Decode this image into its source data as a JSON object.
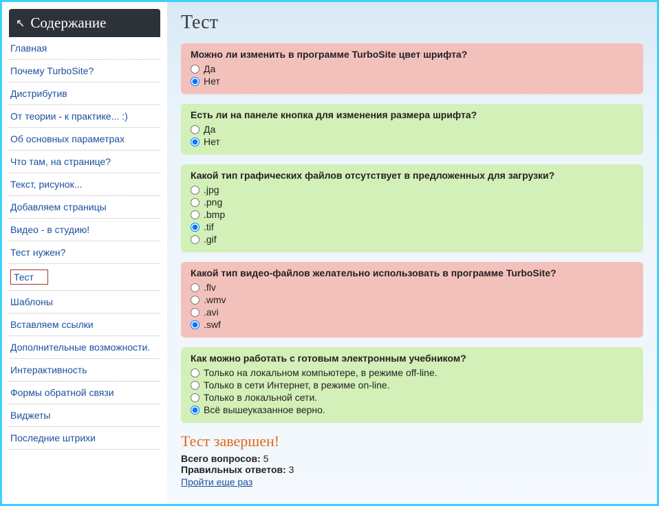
{
  "sidebar": {
    "title": "Содержание",
    "items": [
      {
        "label": "Главная",
        "selected": false
      },
      {
        "label": "Почему TurboSite?",
        "selected": false
      },
      {
        "label": "Дистрибутив",
        "selected": false
      },
      {
        "label": "От теории - к практике... :)",
        "selected": false
      },
      {
        "label": "Об основных параметрах",
        "selected": false
      },
      {
        "label": "Что там, на странице?",
        "selected": false
      },
      {
        "label": "Текст, рисунок...",
        "selected": false
      },
      {
        "label": "Добавляем страницы",
        "selected": false
      },
      {
        "label": "Видео - в студию!",
        "selected": false
      },
      {
        "label": "Тест нужен?",
        "selected": false
      },
      {
        "label": "Тест",
        "selected": true
      },
      {
        "label": "Шаблоны",
        "selected": false
      },
      {
        "label": "Вставляем ссылки",
        "selected": false
      },
      {
        "label": "Дополнительные возможности.",
        "selected": false
      },
      {
        "label": "Интерактивность",
        "selected": false
      },
      {
        "label": "Формы обратной связи",
        "selected": false
      },
      {
        "label": "Виджеты",
        "selected": false
      },
      {
        "label": "Последние штрихи",
        "selected": false
      }
    ]
  },
  "main": {
    "title": "Тест",
    "questions": [
      {
        "text": "Можно ли изменить в программе TurboSite цвет шрифта?",
        "status": "incorrect",
        "options": [
          {
            "label": "Да",
            "checked": false
          },
          {
            "label": "Нет",
            "checked": true
          }
        ]
      },
      {
        "text": "Есть ли на панеле кнопка для изменения размера шрифта?",
        "status": "correct",
        "options": [
          {
            "label": "Да",
            "checked": false
          },
          {
            "label": "Нет",
            "checked": true
          }
        ]
      },
      {
        "text": "Какой тип графических файлов отсутствует в предложенных для загрузки?",
        "status": "correct",
        "options": [
          {
            "label": ".jpg",
            "checked": false
          },
          {
            "label": ".png",
            "checked": false
          },
          {
            "label": ".bmp",
            "checked": false
          },
          {
            "label": ".tif",
            "checked": true
          },
          {
            "label": ".gif",
            "checked": false
          }
        ]
      },
      {
        "text": "Какой тип видео-файлов желательно использовать в программе TurboSite?",
        "status": "incorrect",
        "options": [
          {
            "label": ".flv",
            "checked": false
          },
          {
            "label": ".wmv",
            "checked": false
          },
          {
            "label": ".avi",
            "checked": false
          },
          {
            "label": ".swf",
            "checked": true
          }
        ]
      },
      {
        "text": "Как можно работать с готовым электронным учебником?",
        "status": "correct",
        "options": [
          {
            "label": "Только на локальном компьютере, в режиме off-line.",
            "checked": false
          },
          {
            "label": "Только в сети Интернет, в режиме on-line.",
            "checked": false
          },
          {
            "label": "Только в локальной сети.",
            "checked": false
          },
          {
            "label": "Всё вышеуказанное верно.",
            "checked": true
          }
        ]
      }
    ],
    "result": {
      "title": "Тест завершен!",
      "total_label": "Всего вопросов:",
      "total_value": "5",
      "correct_label": "Правильных ответов:",
      "correct_value": "3",
      "retry": "Пройти еще раз"
    }
  }
}
